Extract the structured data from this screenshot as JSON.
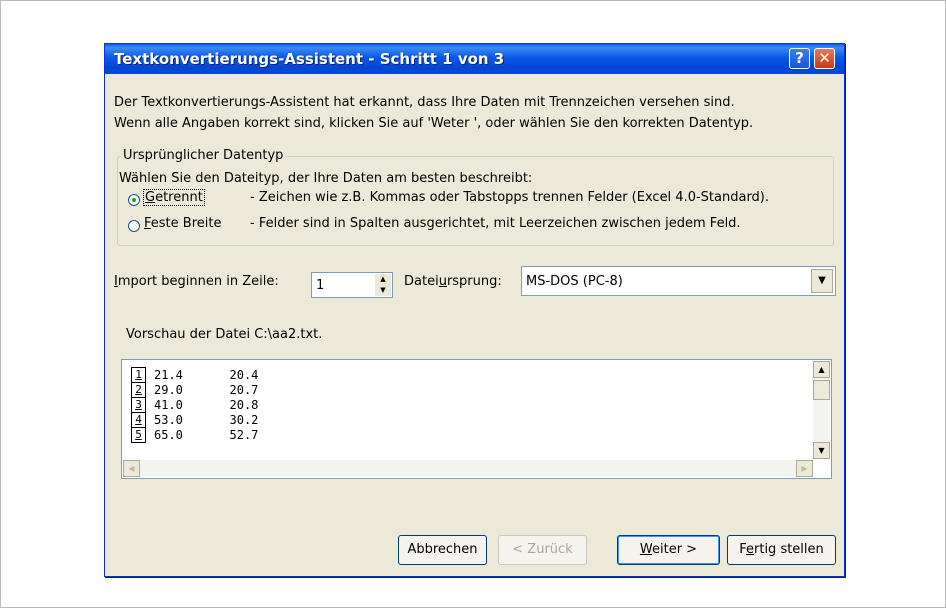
{
  "dialog": {
    "title": "Textkonvertierungs-Assistent - Schritt 1 von 3",
    "help_icon": "?",
    "close_icon": "✕",
    "description_line1": "Der Textkonvertierungs-Assistent hat erkannt, dass Ihre Daten mit Trennzeichen versehen sind.",
    "description_line2": "Wenn alle Angaben korrekt sind, klicken Sie auf 'Weter ', oder wählen Sie den korrekten Datentyp."
  },
  "datatype_group": {
    "legend": "Ursprünglicher Datentyp",
    "prompt": "Wählen Sie den Dateityp, der Ihre Daten am besten beschreibt:",
    "options": [
      {
        "label_hotkey": "G",
        "label_rest": "etrennt",
        "description": "- Zeichen wie z.B. Kommas oder Tabstopps trennen Felder (Excel 4.0-Standard).",
        "selected": true
      },
      {
        "label_hotkey": "F",
        "label_rest": "este Breite",
        "description": "- Felder sind in Spalten ausgerichtet, mit Leerzeichen zwischen jedem Feld.",
        "selected": false
      }
    ]
  },
  "import_start": {
    "label_hotkey": "I",
    "label_rest": "mport beginnen in Zeile:",
    "value": "1"
  },
  "file_origin": {
    "label_pre": "Datei",
    "label_hotkey": "u",
    "label_post": "rsprung:",
    "value": "MS-DOS (PC-8)"
  },
  "preview": {
    "label": "Vorschau der Datei C:\\aa2.txt.",
    "rows": [
      {
        "num": "1",
        "c1": "21.4",
        "c2": "20.4"
      },
      {
        "num": "2",
        "c1": "29.0",
        "c2": "20.7"
      },
      {
        "num": "3",
        "c1": "41.0",
        "c2": "20.8"
      },
      {
        "num": "4",
        "c1": "53.0",
        "c2": "30.2"
      },
      {
        "num": "5",
        "c1": "65.0",
        "c2": "52.7"
      }
    ]
  },
  "buttons": {
    "cancel": "Abbrechen",
    "back": "< Zurück",
    "next_hotkey": "W",
    "next_rest": "eiter >",
    "finish_pre": "F",
    "finish_hotkey": "e",
    "finish_post": "rtig stellen"
  },
  "colors": {
    "titlebar": "#0a58e6",
    "dialog_bg": "#ece9d8",
    "radio_dot": "#21a121"
  }
}
